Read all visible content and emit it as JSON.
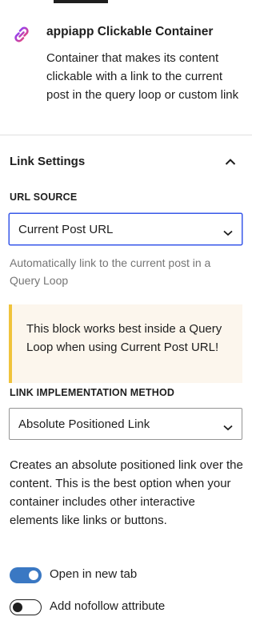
{
  "block": {
    "icon": "link-icon",
    "title": "appiapp Clickable Container",
    "description": "Container that makes its content clickable with a link to the current post in the query loop or custom link"
  },
  "panel": {
    "title": "Link Settings",
    "expanded": true
  },
  "url_source": {
    "label": "URL SOURCE",
    "value": "Current Post URL",
    "help": "Automatically link to the current post in a Query Loop"
  },
  "notice": {
    "text": "This block works best inside a Query Loop when using Current Post URL!",
    "accent": "#f0c33c",
    "background": "#fcf6ed"
  },
  "link_method": {
    "label": "LINK IMPLEMENTATION METHOD",
    "value": "Absolute Positioned Link",
    "description": "Creates an absolute positioned link over the content. This is the best option when your container includes other interactive elements like links or buttons."
  },
  "toggles": [
    {
      "label": "Open in new tab",
      "checked": true
    },
    {
      "label": "Add nofollow attribute",
      "checked": false
    }
  ],
  "colors": {
    "accent": "#3858e9",
    "toggle_on": "#3a78c3",
    "text": "#1e1e1e",
    "muted": "#757575"
  }
}
